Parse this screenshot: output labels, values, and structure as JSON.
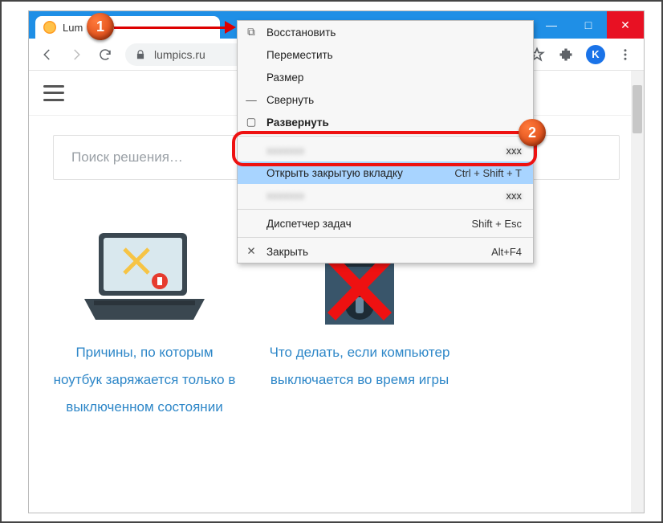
{
  "window": {
    "tab_title": "Lum",
    "controls": {
      "min": "—",
      "max": "□",
      "close": "✕"
    }
  },
  "addressbar": {
    "url": "lumpics.ru",
    "avatar_letter": "K"
  },
  "page": {
    "search_placeholder": "Поиск решения…",
    "cards": [
      {
        "title": "Причины, по которым ноутбук заряжается только в выключенном состоянии"
      },
      {
        "title": "Что делать, если компьютер выключается во время игры"
      }
    ]
  },
  "context_menu": {
    "items": [
      {
        "icon": "restore",
        "label": "Восстановить",
        "shortcut": ""
      },
      {
        "icon": "",
        "label": "Переместить",
        "shortcut": ""
      },
      {
        "icon": "",
        "label": "Размер",
        "shortcut": ""
      },
      {
        "icon": "min",
        "label": "Свернуть",
        "shortcut": ""
      },
      {
        "icon": "max",
        "label": "Развернуть",
        "shortcut": ""
      },
      {
        "sep": true
      },
      {
        "obscured": true
      },
      {
        "label": "Открыть закрытую вкладку",
        "shortcut": "Ctrl + Shift + T",
        "highlight": true
      },
      {
        "obscured": true
      },
      {
        "sep": true
      },
      {
        "label": "Диспетчер задач",
        "shortcut": "Shift + Esc"
      },
      {
        "sep": true
      },
      {
        "icon": "close",
        "label": "Закрыть",
        "shortcut": "Alt+F4"
      }
    ]
  },
  "markers": {
    "1": "1",
    "2": "2"
  }
}
